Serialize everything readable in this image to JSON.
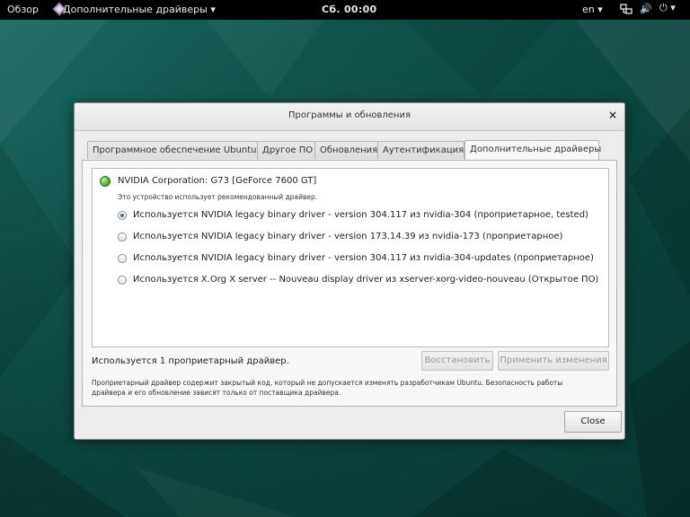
{
  "topbar": {
    "activities": "Обзор",
    "app_menu": "Дополнительные драйверы ▾",
    "clock": "Сб. 00:00",
    "language": "en ▾",
    "network_icon": "network-icon",
    "volume_icon": "volume-icon",
    "power_icon": "power-icon",
    "volume_glyph": "🔊",
    "power_glyph": "⏻ ▾"
  },
  "dialog": {
    "title": "Программы и обновления",
    "close_glyph": "×",
    "tabs": [
      {
        "label": "Программное обеспечение Ubuntu",
        "active": false
      },
      {
        "label": "Другое ПО",
        "active": false
      },
      {
        "label": "Обновления",
        "active": false
      },
      {
        "label": "Аутентификация",
        "active": false
      },
      {
        "label": "Дополнительные драйверы",
        "active": true
      }
    ],
    "device": {
      "name": "NVIDIA Corporation: G73 [GeForce 7600 GT]",
      "description": "Это устройство использует рекомендованный драйвер.",
      "status_color": "#4fb52c"
    },
    "options": [
      {
        "label": "Используется NVIDIA legacy binary driver - version 304.117 из nvidia-304 (проприетарное, tested)",
        "selected": true
      },
      {
        "label": "Используется NVIDIA legacy binary driver - version 173.14.39 из nvidia-173 (проприетарное)",
        "selected": false
      },
      {
        "label": "Используется NVIDIA legacy binary driver - version 304.117 из nvidia-304-updates (проприетарное)",
        "selected": false
      },
      {
        "label": "Используется X.Org X server -- Nouveau display driver из xserver-xorg-video-nouveau (Открытое ПО)",
        "selected": false
      }
    ],
    "status_text": "Используется 1 проприетарный драйвер.",
    "restore_label": "Восстановить",
    "apply_label": "Применить изменения",
    "note_line1": "Проприетарный драйвер содержит закрытый код, который не допускается изменять разработчикам Ubuntu. Безопасность работы",
    "note_line2": "драйвера и его обновление зависят только от поставщика драйвера.",
    "close_label": "Close"
  }
}
